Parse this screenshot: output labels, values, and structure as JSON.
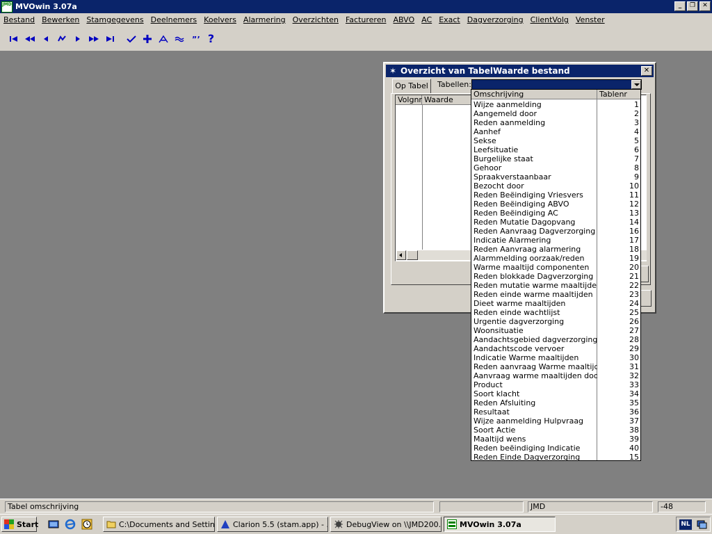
{
  "window": {
    "title": "MVOwin 3.07a",
    "icon_text": "JMD"
  },
  "menu": [
    "Bestand",
    "Bewerken",
    "Stamgegevens",
    "Deelnemers",
    "Koelvers",
    "Alarmering",
    "Overzichten",
    "Factureren",
    "ABVO",
    "AC",
    "Exact",
    "Dagverzorging",
    "ClientVolg",
    "Venster"
  ],
  "toolbar": {
    "icons": [
      "first-icon",
      "previous-page-icon",
      "previous-icon",
      "go-icon",
      "next-icon",
      "next-page-icon",
      "last-icon",
      "check-icon",
      "add-icon",
      "edit-icon",
      "approx-icon",
      "quote-icon",
      "help-icon"
    ],
    "help_label": "?"
  },
  "dialog": {
    "title": "Overzicht van TabelWaarde bestand",
    "tab_label": "Op Tabel",
    "tabellen_label": "Tabellen:",
    "list_columns": [
      "Volgnr",
      "Waarde"
    ]
  },
  "dropdown": {
    "columns": [
      "Omschrijving",
      "Tablenr"
    ],
    "rows": [
      {
        "name": "Wijze aanmelding",
        "nr": "1"
      },
      {
        "name": "Aangemeld door",
        "nr": "2"
      },
      {
        "name": "Reden aanmelding",
        "nr": "3"
      },
      {
        "name": "Aanhef",
        "nr": "4"
      },
      {
        "name": "Sekse",
        "nr": "5"
      },
      {
        "name": "Leefsituatie",
        "nr": "6"
      },
      {
        "name": "Burgelijke staat",
        "nr": "7"
      },
      {
        "name": "Gehoor",
        "nr": "8"
      },
      {
        "name": "Spraakverstaanbaar",
        "nr": "9"
      },
      {
        "name": "Bezocht door",
        "nr": "10"
      },
      {
        "name": "Reden Beëindiging Vriesvers",
        "nr": "11"
      },
      {
        "name": "Reden Beëindiging ABVO",
        "nr": "12"
      },
      {
        "name": "Reden Beëindiging AC",
        "nr": "13"
      },
      {
        "name": "Reden Mutatie Dagopvang",
        "nr": "14"
      },
      {
        "name": "Reden Aanvraag Dagverzorging",
        "nr": "16"
      },
      {
        "name": "Indicatie Alarmering",
        "nr": "17"
      },
      {
        "name": "Reden Aanvraag alarmering",
        "nr": "18"
      },
      {
        "name": "Alarmmelding oorzaak/reden",
        "nr": "19"
      },
      {
        "name": "Warme maaltijd componenten",
        "nr": "20"
      },
      {
        "name": "Reden blokkade Dagverzorging",
        "nr": "21"
      },
      {
        "name": "Reden mutatie warme maaltijden",
        "nr": "22"
      },
      {
        "name": "Reden einde warme maaltijden",
        "nr": "23"
      },
      {
        "name": "Dieet warme maaltijden",
        "nr": "24"
      },
      {
        "name": "Reden einde wachtlijst",
        "nr": "25"
      },
      {
        "name": "Urgentie dagverzorging",
        "nr": "26"
      },
      {
        "name": "Woonsituatie",
        "nr": "27"
      },
      {
        "name": "Aandachtsgebied dagverzorging",
        "nr": "28"
      },
      {
        "name": "Aandachtscode vervoer",
        "nr": "29"
      },
      {
        "name": "Indicatie Warme maaltijden",
        "nr": "30"
      },
      {
        "name": "Reden aanvraag Warme maaltijde",
        "nr": "31"
      },
      {
        "name": "Aanvraag warme maaltijden door",
        "nr": "32"
      },
      {
        "name": "Product",
        "nr": "33"
      },
      {
        "name": "Soort klacht",
        "nr": "34"
      },
      {
        "name": "Reden Afsluiting",
        "nr": "35"
      },
      {
        "name": "Resultaat",
        "nr": "36"
      },
      {
        "name": "Wijze aanmelding Hulpvraag",
        "nr": "37"
      },
      {
        "name": "Soort Actie",
        "nr": "38"
      },
      {
        "name": "Maaltijd wens",
        "nr": "39"
      },
      {
        "name": "Reden beëindiging Indicatie",
        "nr": "40"
      },
      {
        "name": "Reden Einde Dagverzorging",
        "nr": "15"
      }
    ]
  },
  "statusbar": {
    "panels": [
      "Tabel omschrijving",
      "",
      "JMD",
      "-48"
    ]
  },
  "taskbar": {
    "start_label": "Start",
    "tasks": [
      {
        "label": "C:\\Documents and Settin...",
        "icon": "folder-icon"
      },
      {
        "label": "Clarion 5.5 (stam.app) - ...",
        "icon": "clarion-icon"
      },
      {
        "label": "DebugView on \\\\JMD200...",
        "icon": "debugview-icon"
      },
      {
        "label": "MVOwin 3.07a",
        "icon": "mvowin-icon"
      }
    ],
    "language": "NL"
  }
}
